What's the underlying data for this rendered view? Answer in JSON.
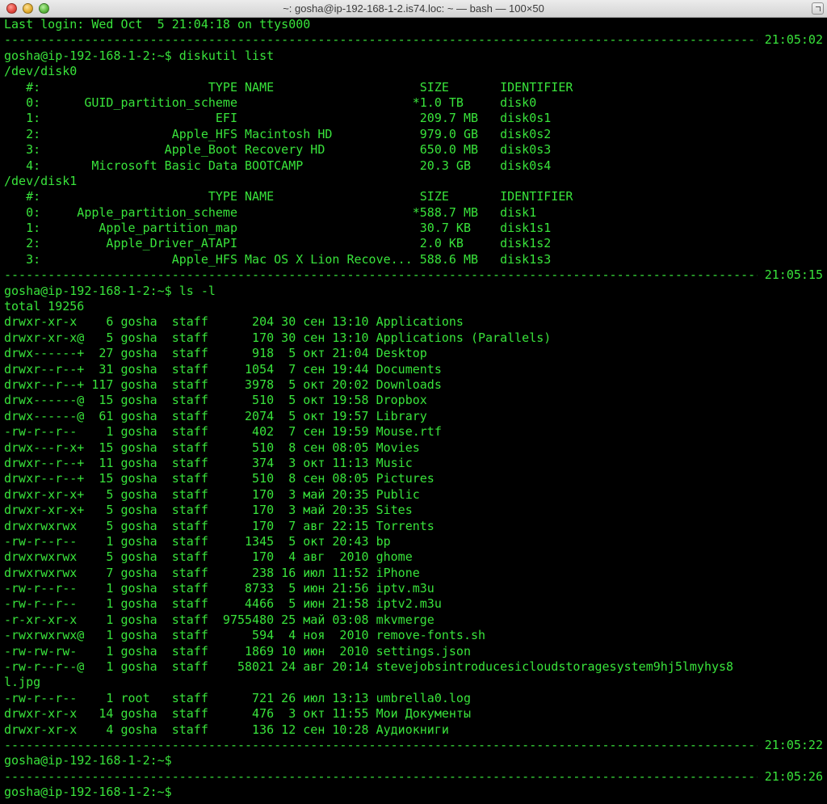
{
  "window": {
    "title": "~: gosha@ip-192-168-1-2.is74.loc: ~ — bash — 100×50"
  },
  "terminal": {
    "lines": [
      {
        "kind": "text",
        "text": "Last login: Wed Oct  5 21:04:18 on ttys000"
      },
      {
        "kind": "sep",
        "time": "21:05:02"
      },
      {
        "kind": "text",
        "text": "gosha@ip-192-168-1-2:~$ diskutil list"
      },
      {
        "kind": "text",
        "text": "/dev/disk0"
      },
      {
        "kind": "text",
        "text": "   #:                       TYPE NAME                    SIZE       IDENTIFIER"
      },
      {
        "kind": "text",
        "text": "   0:      GUID_partition_scheme                        *1.0 TB     disk0"
      },
      {
        "kind": "text",
        "text": "   1:                        EFI                         209.7 MB   disk0s1"
      },
      {
        "kind": "text",
        "text": "   2:                  Apple_HFS Macintosh HD            979.0 GB   disk0s2"
      },
      {
        "kind": "text",
        "text": "   3:                 Apple_Boot Recovery HD             650.0 MB   disk0s3"
      },
      {
        "kind": "text",
        "text": "   4:       Microsoft Basic Data BOOTCAMP                20.3 GB    disk0s4"
      },
      {
        "kind": "text",
        "text": "/dev/disk1"
      },
      {
        "kind": "text",
        "text": "   #:                       TYPE NAME                    SIZE       IDENTIFIER"
      },
      {
        "kind": "text",
        "text": "   0:     Apple_partition_scheme                        *588.7 MB   disk1"
      },
      {
        "kind": "text",
        "text": "   1:        Apple_partition_map                         30.7 KB    disk1s1"
      },
      {
        "kind": "text",
        "text": "   2:         Apple_Driver_ATAPI                         2.0 KB     disk1s2"
      },
      {
        "kind": "text",
        "text": "   3:                  Apple_HFS Mac OS X Lion Recove... 588.6 MB   disk1s3"
      },
      {
        "kind": "sep",
        "time": "21:05:15"
      },
      {
        "kind": "text",
        "text": "gosha@ip-192-168-1-2:~$ ls -l"
      },
      {
        "kind": "text",
        "text": "total 19256"
      },
      {
        "kind": "text",
        "text": "drwxr-xr-x    6 gosha  staff      204 30 сен 13:10 Applications"
      },
      {
        "kind": "text",
        "text": "drwxr-xr-x@   5 gosha  staff      170 30 сен 13:10 Applications (Parallels)"
      },
      {
        "kind": "text",
        "text": "drwx------+  27 gosha  staff      918  5 окт 21:04 Desktop"
      },
      {
        "kind": "text",
        "text": "drwxr--r--+  31 gosha  staff     1054  7 сен 19:44 Documents"
      },
      {
        "kind": "text",
        "text": "drwxr--r--+ 117 gosha  staff     3978  5 окт 20:02 Downloads"
      },
      {
        "kind": "text",
        "text": "drwx------@  15 gosha  staff      510  5 окт 19:58 Dropbox"
      },
      {
        "kind": "text",
        "text": "drwx------@  61 gosha  staff     2074  5 окт 19:57 Library"
      },
      {
        "kind": "text",
        "text": "-rw-r--r--    1 gosha  staff      402  7 сен 19:59 Mouse.rtf"
      },
      {
        "kind": "text",
        "text": "drwx---r-x+  15 gosha  staff      510  8 сен 08:05 Movies"
      },
      {
        "kind": "text",
        "text": "drwxr--r--+  11 gosha  staff      374  3 окт 11:13 Music"
      },
      {
        "kind": "text",
        "text": "drwxr--r--+  15 gosha  staff      510  8 сен 08:05 Pictures"
      },
      {
        "kind": "text",
        "text": "drwxr-xr-x+   5 gosha  staff      170  3 май 20:35 Public"
      },
      {
        "kind": "text",
        "text": "drwxr-xr-x+   5 gosha  staff      170  3 май 20:35 Sites"
      },
      {
        "kind": "text",
        "text": "drwxrwxrwx    5 gosha  staff      170  7 авг 22:15 Torrents"
      },
      {
        "kind": "text",
        "text": "-rw-r--r--    1 gosha  staff     1345  5 окт 20:43 bp"
      },
      {
        "kind": "text",
        "text": "drwxrwxrwx    5 gosha  staff      170  4 авг  2010 ghome"
      },
      {
        "kind": "text",
        "text": "drwxrwxrwx    7 gosha  staff      238 16 июл 11:52 iPhone"
      },
      {
        "kind": "text",
        "text": "-rw-r--r--    1 gosha  staff     8733  5 июн 21:56 iptv.m3u"
      },
      {
        "kind": "text",
        "text": "-rw-r--r--    1 gosha  staff     4466  5 июн 21:58 iptv2.m3u"
      },
      {
        "kind": "text",
        "text": "-r-xr-xr-x    1 gosha  staff  9755480 25 май 03:08 mkvmerge"
      },
      {
        "kind": "text",
        "text": "-rwxrwxrwx@   1 gosha  staff      594  4 ноя  2010 remove-fonts.sh"
      },
      {
        "kind": "text",
        "text": "-rw-rw-rw-    1 gosha  staff     1869 10 июн  2010 settings.json"
      },
      {
        "kind": "text",
        "text": "-rw-r--r--@   1 gosha  staff    58021 24 авг 20:14 stevejobsintroducesicloudstoragesystem9hj5lmyhys8"
      },
      {
        "kind": "text",
        "text": "l.jpg"
      },
      {
        "kind": "text",
        "text": "-rw-r--r--    1 root   staff      721 26 июл 13:13 umbrella0.log"
      },
      {
        "kind": "text",
        "text": "drwxr-xr-x   14 gosha  staff      476  3 окт 11:55 Мои Документы"
      },
      {
        "kind": "text",
        "text": "drwxr-xr-x    4 gosha  staff      136 12 сен 10:28 Аудиокниги"
      },
      {
        "kind": "sep",
        "time": "21:05:22"
      },
      {
        "kind": "text",
        "text": "gosha@ip-192-168-1-2:~$"
      },
      {
        "kind": "sep",
        "time": "21:05:26"
      },
      {
        "kind": "text",
        "text": "gosha@ip-192-168-1-2:~$"
      }
    ]
  }
}
